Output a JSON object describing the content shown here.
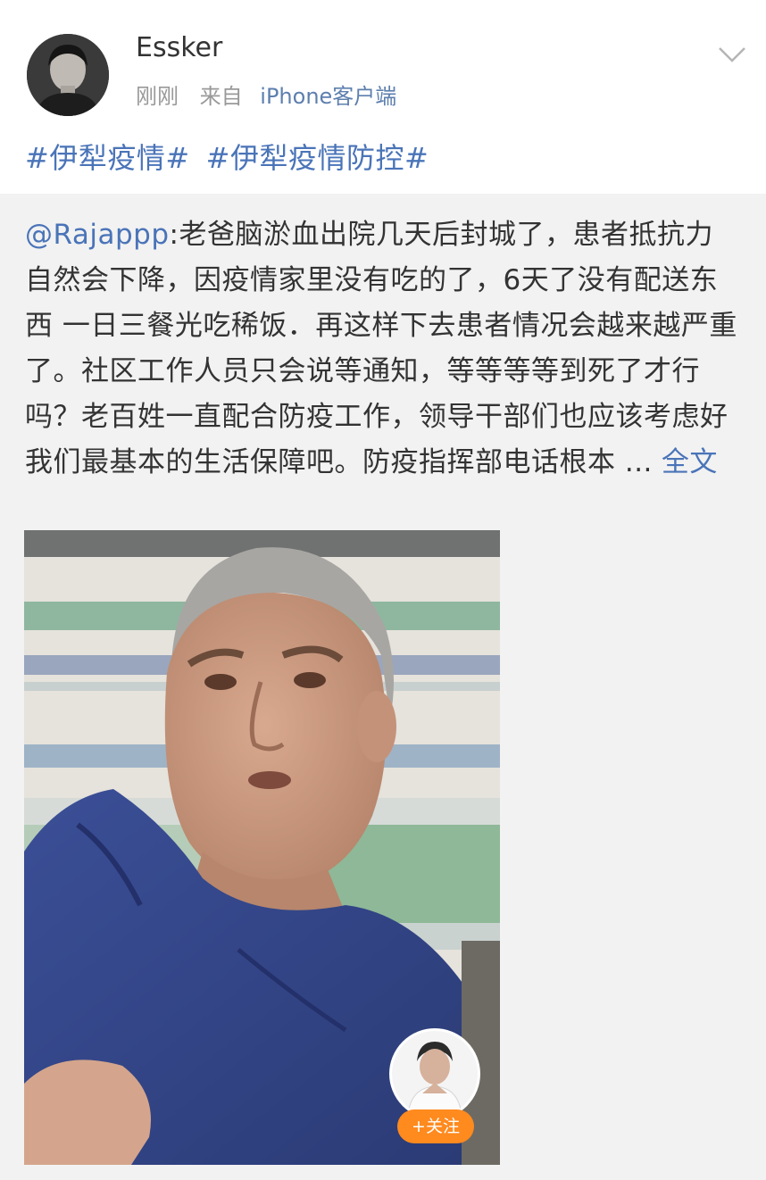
{
  "post": {
    "author": "Essker",
    "time": "刚刚",
    "source_prefix": "来自",
    "source": "iPhone客户端",
    "topics": [
      "#伊犁疫情#",
      "#伊犁疫情防控#"
    ]
  },
  "repost": {
    "mention": "@Rajappp",
    "text": ":老爸脑淤血出院几天后封城了，患者抵抗力自然会下降，因疫情家里没有吃的了，6天了没有配送东西 一日三餐光吃稀饭．再这样下去患者情况会越来越严重了。社区工作人员只会说等通知，等等等等到死了才行吗？老百姓一直配合防疫工作，领导干部们也应该考虑好我们最基本的生活保障吧。防疫指挥部电话根本 ...",
    "full_text_link": "全文"
  },
  "video": {
    "follow_label": "+关注"
  },
  "colors": {
    "link": "#4a74b8",
    "follow": "#ff8a1e",
    "background": "#f2f2f2"
  },
  "icons": {
    "menu": "chevron-down-icon"
  }
}
